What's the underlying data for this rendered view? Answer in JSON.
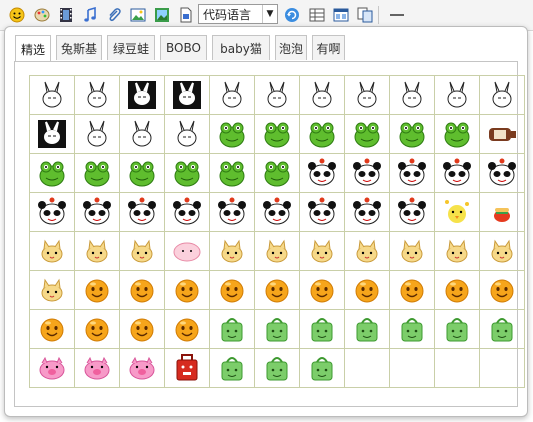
{
  "toolbar": {
    "icons": [
      "smiley-icon",
      "palette-icon",
      "film-icon",
      "music-note-icon",
      "paperclip-icon",
      "image-icon",
      "picture-frame-icon",
      "document-icon"
    ],
    "code_language": "代码语言",
    "right_icons": [
      "refresh-icon",
      "table-icon",
      "window-icon",
      "copy-icon",
      "horizontal-rule-icon"
    ]
  },
  "tabs": [
    {
      "label": "精选",
      "active": true
    },
    {
      "label": "兔斯基",
      "active": false
    },
    {
      "label": "绿豆蛙",
      "active": false
    },
    {
      "label": "BOBO",
      "active": false
    },
    {
      "label": "baby猫",
      "active": false
    },
    {
      "label": "泡泡",
      "active": false
    },
    {
      "label": "有啊",
      "active": false
    }
  ],
  "emoticon_rows": [
    [
      "tuzki",
      "tuzki",
      "tuzki-dark",
      "tuzki-dark",
      "tuzki",
      "tuzki",
      "tuzki",
      "tuzki",
      "tuzki",
      "tuzki",
      "tuzki"
    ],
    [
      "tuzki-dark",
      "tuzki",
      "tuzki",
      "tuzki",
      "frog",
      "frog",
      "frog",
      "frog",
      "frog",
      "frog",
      "bottle"
    ],
    [
      "frog",
      "frog",
      "frog",
      "frog",
      "frog",
      "frog",
      "panda",
      "panda",
      "panda",
      "panda",
      "panda"
    ],
    [
      "panda",
      "panda",
      "panda",
      "panda",
      "panda",
      "panda",
      "panda",
      "panda",
      "panda",
      "chick",
      "tomato"
    ],
    [
      "cat",
      "cat",
      "cat",
      "cloud",
      "cat",
      "cat",
      "cat",
      "cat",
      "cat",
      "cat",
      "cat"
    ],
    [
      "cat",
      "bubble",
      "bubble",
      "bubble",
      "bubble",
      "bubble",
      "bubble",
      "bubble",
      "bubble",
      "bubble",
      "bubble"
    ],
    [
      "bubble",
      "bubble",
      "bubble",
      "bubble",
      "bag",
      "bag",
      "bag",
      "bag",
      "bag",
      "bag",
      "bag"
    ],
    [
      "pig",
      "pig",
      "pig",
      "red-bag",
      "bag",
      "bag",
      "bag",
      "",
      "",
      "",
      ""
    ]
  ],
  "colors": {
    "grid_border": "#c9cfa8",
    "frog": "#5fbd2e",
    "bubble": "#f6a51b",
    "bag": "#7ccd6a",
    "pig": "#f79ac8",
    "red_bag": "#d62b20"
  }
}
